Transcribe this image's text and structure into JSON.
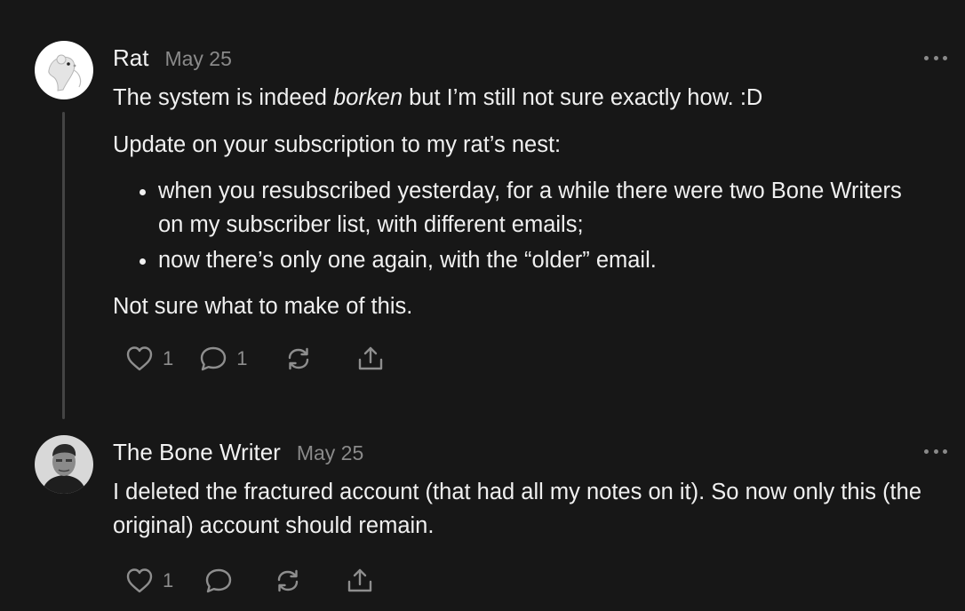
{
  "comments": [
    {
      "author": "Rat",
      "date": "May 25",
      "line1_pre": "The system is indeed ",
      "line1_em": "borken",
      "line1_post": " but I’m still not sure exactly how. :D",
      "update": "Update on your subscription to my rat’s nest:",
      "bullets": [
        "when you resubscribed yesterday, for a while there were two Bone Writers on my subscriber list, with different emails;",
        "now there’s only one again, with the “older” email."
      ],
      "closing": "Not sure what to make of this.",
      "likes": "1",
      "replies": "1"
    },
    {
      "author": "The Bone Writer",
      "date": "May 25",
      "text": "I deleted the fractured account (that had all my notes on it). So now only this (the original) account should remain.",
      "likes": "1"
    }
  ],
  "icons": {
    "like": "heart-icon",
    "reply": "speech-bubble-icon",
    "restack": "restack-arrows-icon",
    "share": "share-upload-icon",
    "more": "more-dots-icon"
  }
}
